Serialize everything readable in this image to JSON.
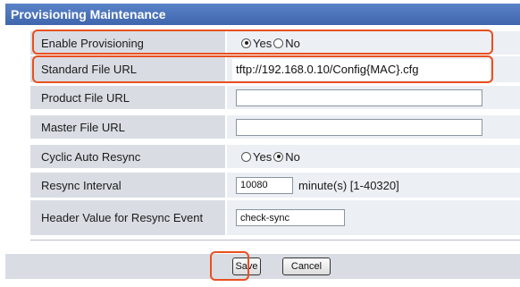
{
  "panel": {
    "title": "Provisioning Maintenance"
  },
  "rows": {
    "enable_provisioning": {
      "label": "Enable Provisioning",
      "options": [
        "Yes",
        "No"
      ],
      "selected": "Yes"
    },
    "standard_file_url": {
      "label": "Standard File URL",
      "value": "tftp://192.168.0.10/Config{MAC}.cfg"
    },
    "product_file_url": {
      "label": "Product File URL",
      "value": ""
    },
    "master_file_url": {
      "label": "Master File URL",
      "value": ""
    },
    "cyclic_auto_resync": {
      "label": "Cyclic Auto Resync",
      "options": [
        "Yes",
        "No"
      ],
      "selected": "No"
    },
    "resync_interval": {
      "label": "Resync Interval",
      "value": "10080",
      "unit": "minute(s) [1-40320]"
    },
    "header_value": {
      "label": "Header Value for Resync Event",
      "value": "check-sync"
    }
  },
  "buttons": {
    "save_label": "Save",
    "cancel_label": "Cancel"
  },
  "colors": {
    "header": "#4a72b8",
    "highlight": "#e8501f"
  }
}
